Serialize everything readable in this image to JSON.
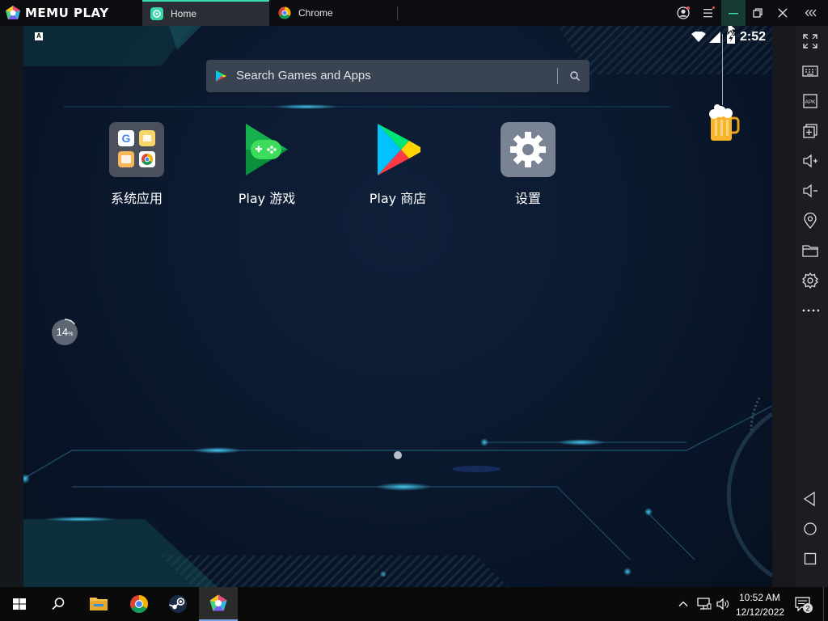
{
  "app": {
    "name": "MEMU PLAY"
  },
  "tabs": [
    {
      "label": "Home",
      "icon": "memu-home-icon",
      "active": true
    },
    {
      "label": "Chrome",
      "icon": "chrome-icon",
      "active": false
    }
  ],
  "status": {
    "time": "2:52",
    "keyboard_indicator": "A"
  },
  "search": {
    "placeholder": "Search Games and Apps"
  },
  "apps": [
    {
      "label": "系统应用",
      "icon": "system-apps-folder-icon"
    },
    {
      "label": "Play 游戏",
      "icon": "play-games-icon"
    },
    {
      "label": "Play 商店",
      "icon": "play-store-icon"
    },
    {
      "label": "设置",
      "icon": "settings-gear-icon"
    }
  ],
  "boost": {
    "value": "14",
    "unit": "%"
  },
  "toolbar": {
    "items": [
      "fullscreen-icon",
      "keyboard-mapping-icon",
      "apk-install-icon",
      "multi-instance-icon",
      "volume-up-icon",
      "volume-down-icon",
      "location-icon",
      "shared-folder-icon",
      "settings-icon",
      "more-icon",
      "back-icon",
      "home-icon",
      "recents-icon"
    ],
    "apk_label": "APK"
  },
  "taskbar": {
    "time": "10:52 AM",
    "date": "12/12/2022",
    "notifications": "2"
  },
  "colors": {
    "accent": "#38e0b0",
    "screen_bg": "#0b1a30",
    "taskbar": "#0a0a0a"
  }
}
